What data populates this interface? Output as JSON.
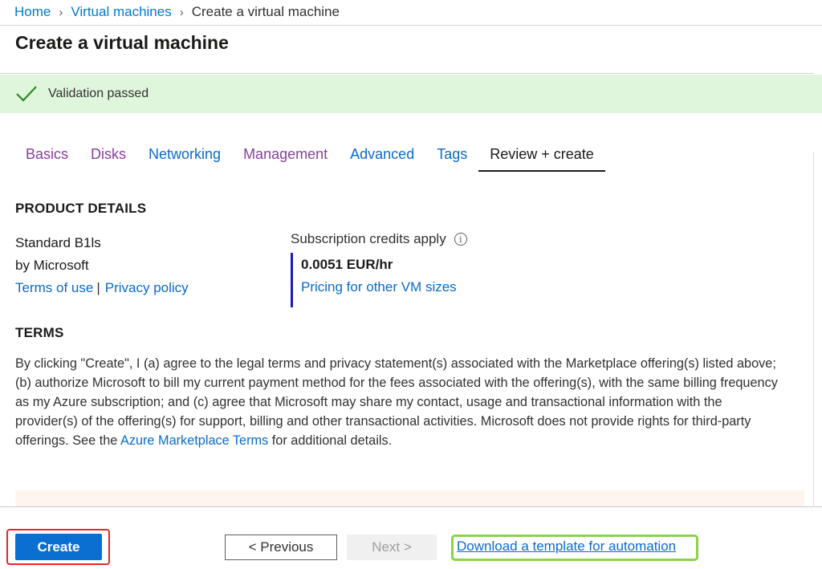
{
  "breadcrumb": {
    "home": "Home",
    "parent": "Virtual machines",
    "current": "Create a virtual machine"
  },
  "page_title": "Create a virtual machine",
  "validation": {
    "message": "Validation passed",
    "icon": "check-icon"
  },
  "tabs": [
    {
      "label": "Basics",
      "state": "visited"
    },
    {
      "label": "Disks",
      "state": "visited"
    },
    {
      "label": "Networking",
      "state": "link"
    },
    {
      "label": "Management",
      "state": "visited"
    },
    {
      "label": "Advanced",
      "state": "link"
    },
    {
      "label": "Tags",
      "state": "link"
    },
    {
      "label": "Review + create",
      "state": "active"
    }
  ],
  "product_details": {
    "heading": "PRODUCT DETAILS",
    "name": "Standard B1ls",
    "publisher": "by Microsoft",
    "terms_of_use": "Terms of use",
    "separator": "|",
    "privacy_policy": "Privacy policy",
    "credits_label": "Subscription credits apply",
    "info_icon": "i",
    "price": "0.0051 EUR/hr",
    "pricing_link": "Pricing for other VM sizes"
  },
  "terms": {
    "heading": "TERMS",
    "text_before": "By clicking \"Create\", I (a) agree to the legal terms and privacy statement(s) associated with the Marketplace offering(s) listed above; (b) authorize Microsoft to bill my current payment method for the fees associated with the offering(s), with the same billing frequency as my Azure subscription; and (c) agree that Microsoft may share my contact, usage and transactional information with the provider(s) of the offering(s) for support, billing and other transactional activities. Microsoft does not provide rights for third-party offerings. See the ",
    "link": "Azure Marketplace Terms",
    "text_after": " for additional details."
  },
  "footer": {
    "create": "Create",
    "previous": "< Previous",
    "next": "Next >",
    "download": "Download a template for automation"
  },
  "colors": {
    "accent": "#0a6fd0",
    "link": "#0a6ac9",
    "visited": "#8a3d9e",
    "success_bg": "#dff6dd",
    "success_check": "#2e8b22",
    "highlight_red": "#e8262b",
    "highlight_green": "#8bd14b"
  }
}
